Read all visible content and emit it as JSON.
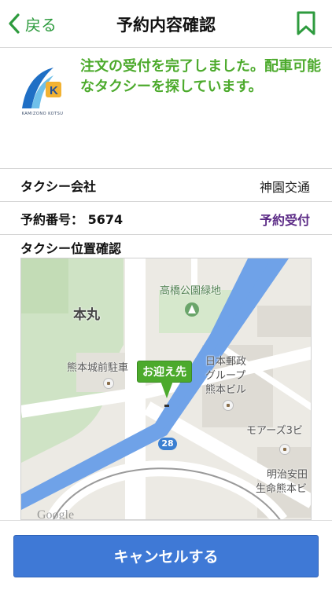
{
  "nav": {
    "back_label": "戻る",
    "title": "予約内容確認"
  },
  "banner": {
    "logo_caption": "KAMIZONO KOTSU",
    "message": "注文の受付を完了しました。配車可能なタクシーを探しています。"
  },
  "details": {
    "company_label": "タクシー会社",
    "company_value": "神園交通",
    "reservation_label": "予約番号： 5674",
    "reservation_status": "予約受付"
  },
  "map_section": {
    "heading": "タクシー位置確認",
    "labels": {
      "honmaru": "本丸",
      "takahashi_park": "高橋公園緑地",
      "parking": "熊本城前駐車",
      "postal_1": "日本郵政",
      "postal_2": "グループ",
      "postal_3": "熊本ビル",
      "moas": "モアーズ3ビ",
      "meiji_1": "明治安田",
      "meiji_2": "生命熊本ビ",
      "route": "28",
      "google": "Google"
    },
    "pin_label": "お迎え先"
  },
  "actions": {
    "cancel_label": "キャンセルする"
  },
  "colors": {
    "accent_green": "#4caa2c",
    "status_purple": "#5b2a86",
    "button_blue": "#3f79d6",
    "river_blue": "#6fa2e8"
  }
}
